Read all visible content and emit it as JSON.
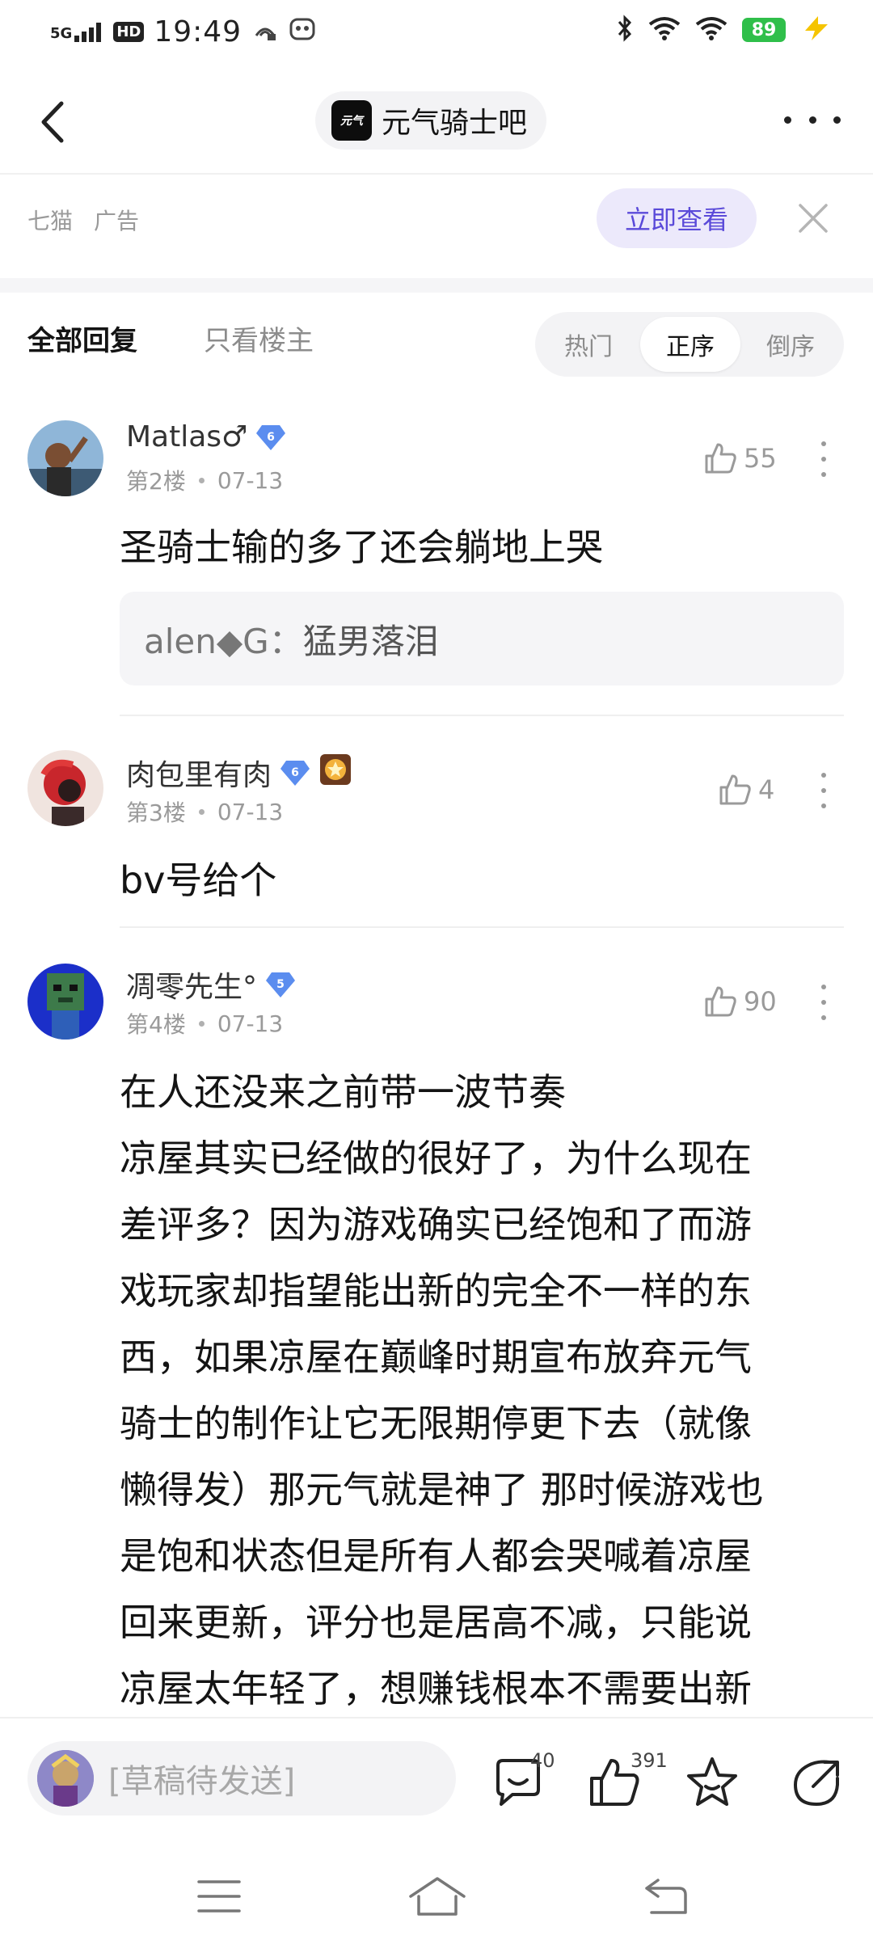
{
  "status_bar": {
    "network": "5G",
    "hd": "HD",
    "time": "19:49",
    "battery": "89"
  },
  "nav": {
    "forum_logo_text": "元气",
    "forum_name": "元气骑士吧"
  },
  "ad": {
    "source": "七猫",
    "label": "广告",
    "button": "立即查看"
  },
  "tabs": {
    "all": "全部回复",
    "owner_only": "只看楼主",
    "sort": [
      "热门",
      "正序",
      "倒序"
    ],
    "sort_active": "正序"
  },
  "posts": [
    {
      "username": "Matlas♂",
      "level": "6",
      "floor": "第2楼",
      "date": "07-13",
      "likes": "55",
      "content": "圣骑士输的多了还会躺地上哭",
      "reply": {
        "user": "alen◆G：",
        "text": "猛男落泪"
      }
    },
    {
      "username": "肉包里有肉",
      "level": "6",
      "floor": "第3楼",
      "date": "07-13",
      "likes": "4",
      "content": "bv号给个"
    },
    {
      "username": "凋零先生°",
      "level": "5",
      "floor": "第4楼",
      "date": "07-13",
      "likes": "90",
      "content_lines": [
        "在人还没来之前带一波节奏",
        "凉屋其实已经做的很好了，为什么现在",
        "差评多？因为游戏确实已经饱和了而游",
        "戏玩家却指望能出新的完全不一样的东",
        "西，如果凉屋在巅峰时期宣布放弃元气",
        "骑士的制作让它无限期停更下去（就像",
        "懒得发）那元气就是神了 那时候游戏也",
        "是饱和状态但是所有人都会哭喊着凉屋",
        "回来更新，评分也是居高不减，只能说",
        "凉屋太年轻了，想赚钱根本不需要出新"
      ]
    }
  ],
  "bottom_bar": {
    "draft_placeholder": "[草稿待发送]",
    "comments": "40",
    "likes": "391"
  },
  "colors": {
    "accent": "#5a4ad9",
    "accent_bg": "#ece9fb",
    "level_badge": "#5b8def",
    "battery": "#2fbf4a"
  }
}
